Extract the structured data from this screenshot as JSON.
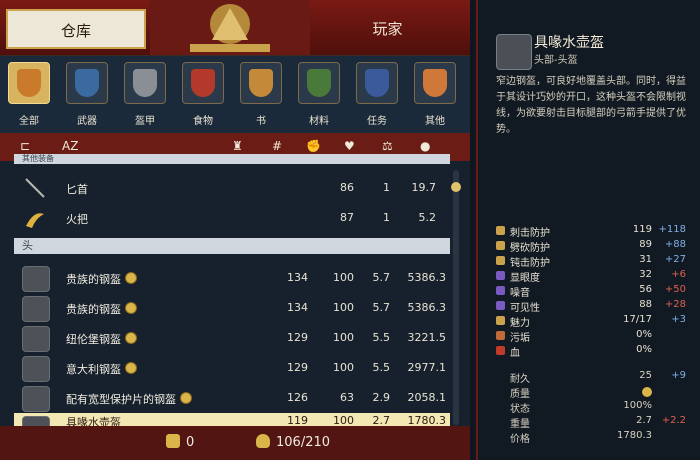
{
  "tabs": {
    "storage": "仓库",
    "player": "玩家"
  },
  "categories": [
    {
      "label": "全部",
      "active": true,
      "color": "#c97a2a"
    },
    {
      "label": "武器",
      "active": false,
      "color": "#3a6aa0"
    },
    {
      "label": "盔甲",
      "active": false,
      "color": "#8a8f96"
    },
    {
      "label": "食物",
      "active": false,
      "color": "#b33a2a"
    },
    {
      "label": "书",
      "active": false,
      "color": "#c48a3a"
    },
    {
      "label": "材料",
      "active": false,
      "color": "#4a7a3a"
    },
    {
      "label": "任务",
      "active": false,
      "color": "#3a5a9a"
    },
    {
      "label": "其他",
      "active": false,
      "color": "#d0783a"
    }
  ],
  "sortbar": {
    "az": "AZ",
    "hash": "#"
  },
  "group_top_label": "其他装备",
  "items_other": [
    {
      "name": "匕首",
      "weight_col": "86",
      "qty": "1",
      "price": "19.7"
    },
    {
      "name": "火把",
      "weight_col": "87",
      "qty": "1",
      "price": "5.2"
    }
  ],
  "group_head_label": "头",
  "items_head": [
    {
      "name": "贵族的钢盔",
      "c1": "134",
      "c2": "100",
      "c3": "5.7",
      "c4": "5386.3"
    },
    {
      "name": "贵族的钢盔",
      "c1": "134",
      "c2": "100",
      "c3": "5.7",
      "c4": "5386.3"
    },
    {
      "name": "纽伦堡钢盔",
      "c1": "129",
      "c2": "100",
      "c3": "5.5",
      "c4": "3221.5"
    },
    {
      "name": "意大利钢盔",
      "c1": "129",
      "c2": "100",
      "c3": "5.5",
      "c4": "2977.1"
    },
    {
      "name": "配有宽型保护片的钢盔",
      "c1": "126",
      "c2": "63",
      "c3": "2.9",
      "c4": "2058.1"
    },
    {
      "name": "具喙水壶盔",
      "c1": "119",
      "c2": "100",
      "c3": "2.7",
      "c4": "1780.3"
    }
  ],
  "footer": {
    "coins": "0",
    "capacity": "106/210"
  },
  "detail": {
    "title": "具喙水壶盔",
    "subtitle": "头部-头盔",
    "description": "窄边钢盔，可良好地覆盖头部。同时，得益于其设计巧妙的开口，这种头盔不会限制视线，为欲要射击目标腿部的弓箭手提供了优势。",
    "stats": [
      {
        "label": "刺击防护",
        "value": "119",
        "delta": "+118",
        "neg": false,
        "color": "#c9a24b"
      },
      {
        "label": "劈砍防护",
        "value": "89",
        "delta": "+88",
        "neg": false,
        "color": "#c9a24b"
      },
      {
        "label": "钝击防护",
        "value": "31",
        "delta": "+27",
        "neg": false,
        "color": "#c9a24b"
      },
      {
        "label": "显眼度",
        "value": "32",
        "delta": "+6",
        "neg": true,
        "color": "#7a5ac0"
      },
      {
        "label": "噪音",
        "value": "56",
        "delta": "+50",
        "neg": true,
        "color": "#7a5ac0"
      },
      {
        "label": "可见性",
        "value": "88",
        "delta": "+28",
        "neg": true,
        "color": "#7a5ac0"
      },
      {
        "label": "魅力",
        "value": "17/17",
        "delta": "+3",
        "neg": false,
        "color": "#c9a24b"
      },
      {
        "label": "污垢",
        "value": "0%",
        "delta": "",
        "neg": false,
        "color": "#c06a3a"
      },
      {
        "label": "血",
        "value": "0%",
        "delta": "",
        "neg": false,
        "color": "#c03a2a"
      }
    ],
    "lower": [
      {
        "label": "耐久",
        "value": "25",
        "delta": "+9",
        "neg": false
      },
      {
        "label": "质量",
        "value": "",
        "delta": "",
        "neg": false,
        "coin": true
      },
      {
        "label": "状态",
        "value": "100%",
        "delta": "",
        "neg": false
      },
      {
        "label": "重量",
        "value": "2.7",
        "delta": "+2.2",
        "neg": true
      },
      {
        "label": "价格",
        "value": "1780.3",
        "delta": "",
        "neg": false
      }
    ]
  }
}
